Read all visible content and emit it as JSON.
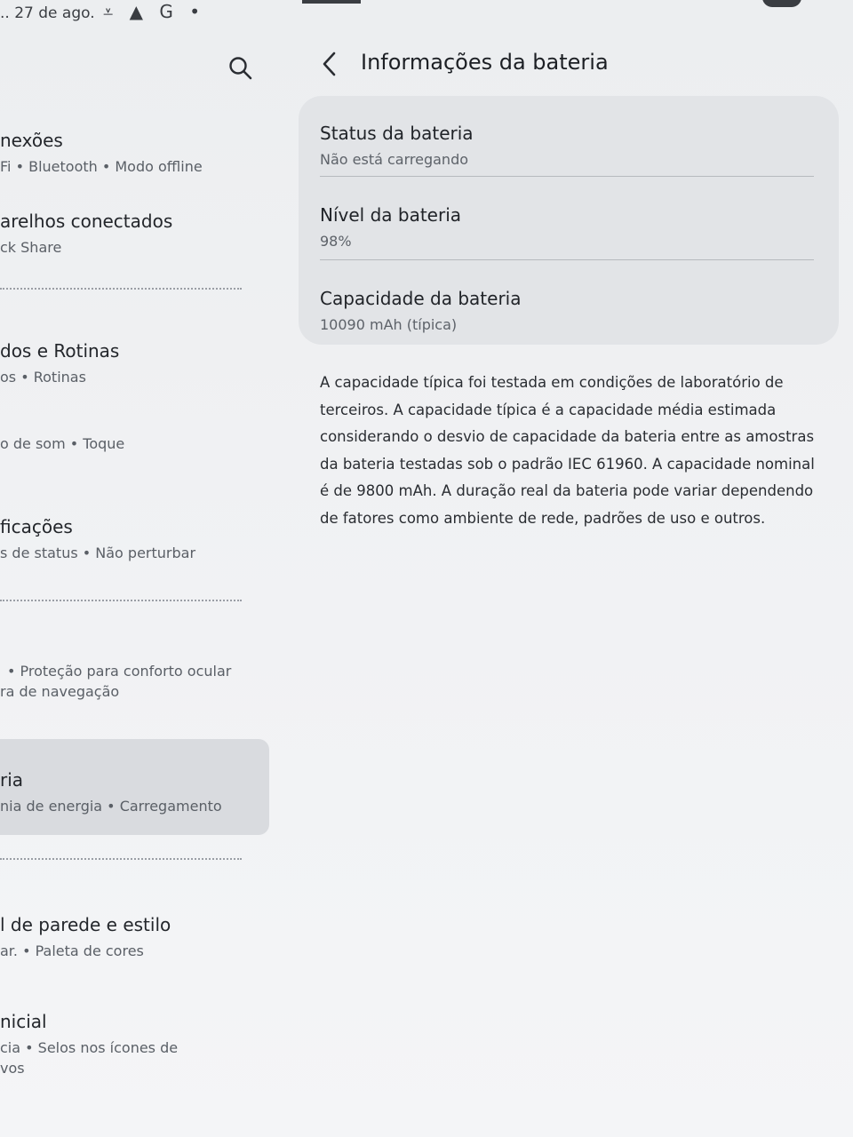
{
  "status_bar": {
    "date": ".. 27 de ago.",
    "icons": [
      "download-done-icon",
      "warning-icon",
      "google-icon",
      "dot-icon"
    ],
    "icons_text": "⩡ ▲ G •"
  },
  "left_menu": {
    "items": [
      {
        "title": "nexões",
        "sub": "Fi  •  Bluetooth  •  Modo offline"
      },
      {
        "title": "arelhos conectados",
        "sub": "ck Share"
      },
      {
        "title": "dos e Rotinas",
        "sub": "os  •  Rotinas"
      },
      {
        "title": "",
        "sub": "o de som  •  Toque"
      },
      {
        "title": "ficações",
        "sub": "s de status  •  Não perturbar"
      },
      {
        "title": "",
        "sub": "•  Proteção para conforto ocular",
        "sub2": "ra de navegação"
      },
      {
        "title": "ria",
        "sub": "nia de energia  •  Carregamento"
      },
      {
        "title": "l de parede e estilo",
        "sub": "ar.  •  Paleta de cores"
      },
      {
        "title": "nicial",
        "sub": "cia  •  Selos nos ícones de",
        "sub2": "vos"
      }
    ]
  },
  "detail": {
    "title": "Informações da bateria",
    "rows": [
      {
        "label": "Status da bateria",
        "value": "Não está carregando"
      },
      {
        "label": "Nível da bateria",
        "value": "98%"
      },
      {
        "label": "Capacidade da bateria",
        "value": "10090 mAh (típica)"
      }
    ],
    "description": "A capacidade típica foi testada em condições de laboratório de terceiros. A capacidade típica é a capacidade média estimada considerando o desvio de capacidade da bateria entre as amostras da bateria testadas sob o padrão IEC 61960. A capacidade nominal é de 9800 mAh. A duração real da bateria pode variar dependendo de fatores como ambiente de rede, padrões de uso e outros."
  }
}
